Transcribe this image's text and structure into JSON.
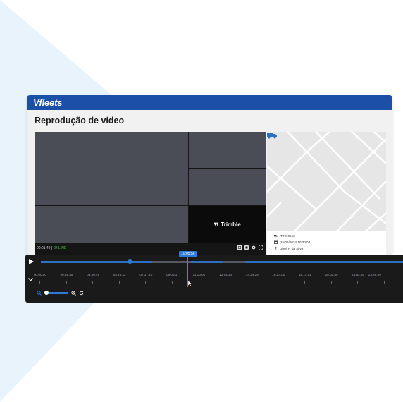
{
  "app": {
    "logo": "Vfleets",
    "page_title": "Reprodução de vídeo"
  },
  "video": {
    "elapsed": "00:01:49",
    "separator": " | ",
    "status": "ONLINE",
    "brand_tile": "Trimble"
  },
  "map_info": {
    "vehicle": "TTC-0010",
    "datetime": "15/06/2024 10:30:04",
    "driver": "José F. da Silva"
  },
  "timeline": {
    "current_time": "10:05:56",
    "ticks": [
      "00:00:00",
      "00:01:45",
      "03:39:45",
      "05:28:12",
      "07:17:20",
      "09:05:17",
      "11:10:00",
      "12:54:34",
      "14:34:25",
      "16:24:00",
      "18:14:01",
      "20:02:40",
      "21:52:56",
      "23:59:59"
    ]
  },
  "colors": {
    "brand_blue": "#1b4fa8",
    "accent_blue": "#2d7ad6",
    "online_green": "#48b84c"
  }
}
